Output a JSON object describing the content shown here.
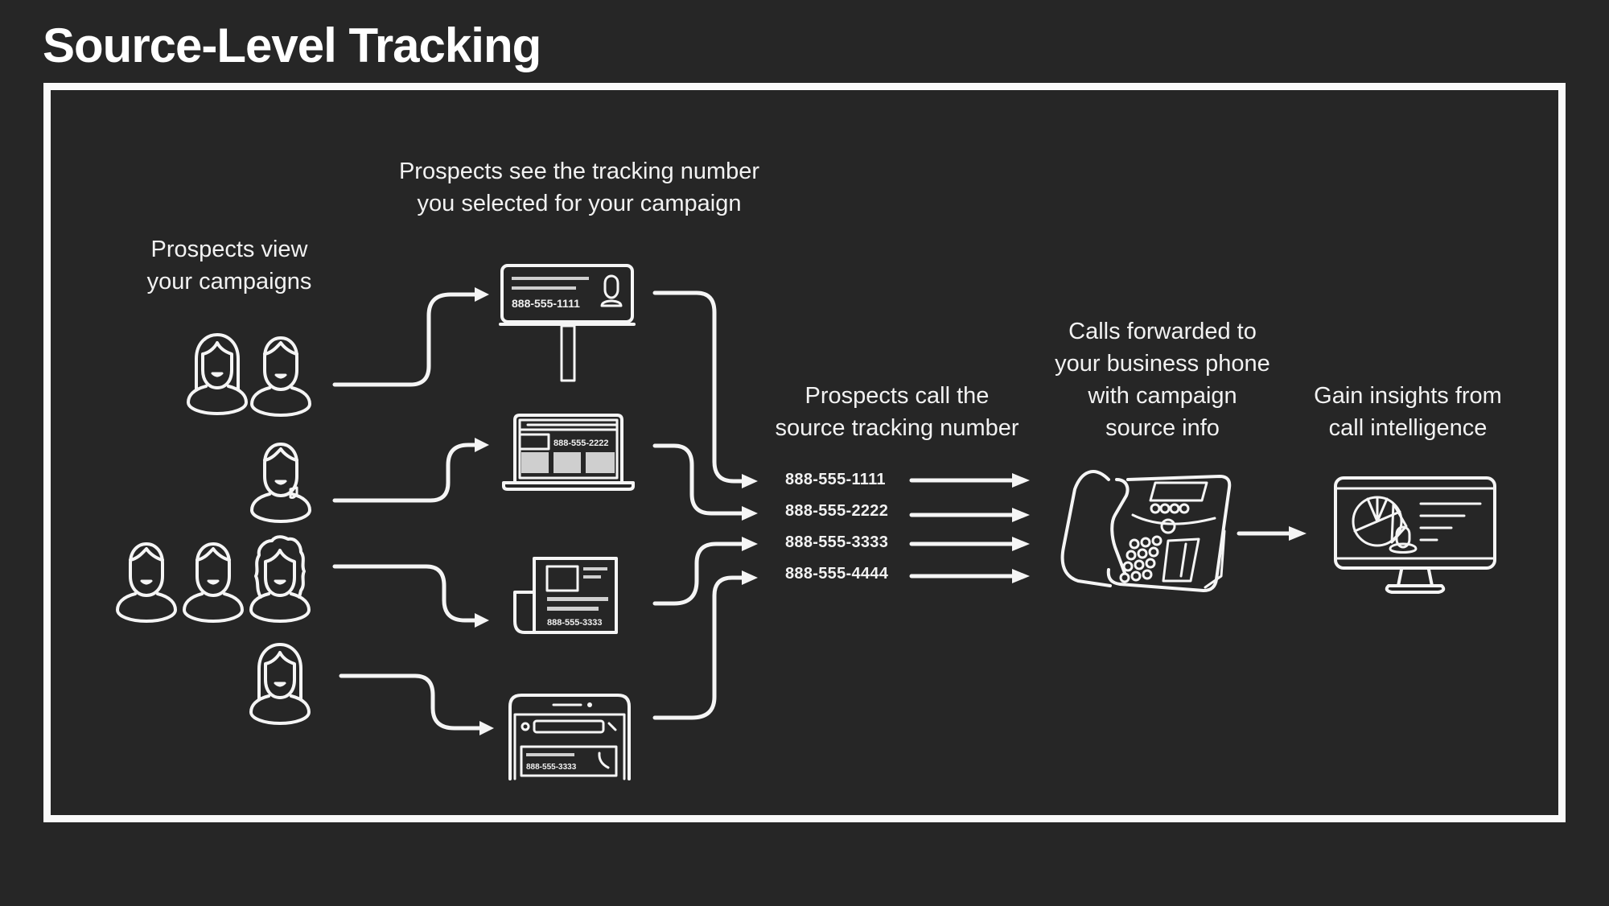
{
  "title": "Source-Level Tracking",
  "captions": {
    "view_campaigns": [
      "Prospects view",
      "your campaigns"
    ],
    "see_number": [
      "Prospects see the tracking number",
      "you selected for your campaign"
    ],
    "call_number": [
      "Prospects call the",
      "source tracking number"
    ],
    "forwarded": [
      "Calls forwarded to",
      "your business phone",
      "with campaign",
      "source info"
    ],
    "insights": [
      "Gain insights from",
      "call intelligence"
    ]
  },
  "channels": [
    {
      "name": "billboard",
      "icon": "billboard-icon",
      "number": "888-555-1111",
      "prospects": [
        "woman-long-hair",
        "man"
      ]
    },
    {
      "name": "website",
      "icon": "laptop-icon",
      "number": "888-555-2222",
      "prospects": [
        "man-with-badge"
      ]
    },
    {
      "name": "print",
      "icon": "newspaper-icon",
      "number": "888-555-3333",
      "prospects": [
        "man",
        "man",
        "woman-curly-hair"
      ]
    },
    {
      "name": "search",
      "icon": "mobile-search-icon",
      "number": "888-555-3333",
      "prospects": [
        "woman-long-hair"
      ]
    }
  ],
  "tracking_numbers": [
    "888-555-1111",
    "888-555-2222",
    "888-555-3333",
    "888-555-4444"
  ],
  "destinations": {
    "business_phone_icon": "desk-phone-icon",
    "insights_icon": "analytics-monitor-icon"
  },
  "colors": {
    "background": "#262626",
    "foreground": "#f5f5f5"
  }
}
